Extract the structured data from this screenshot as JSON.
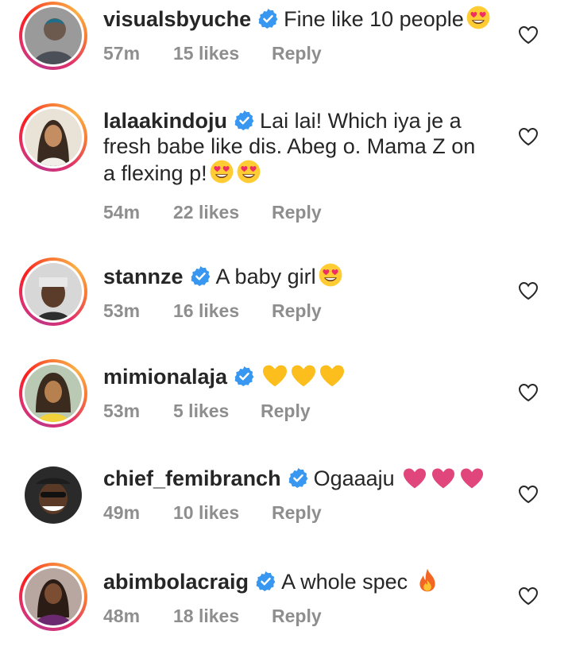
{
  "comments": [
    {
      "username": "visualsbyuche",
      "text": "Fine like 10 people",
      "emojis": [
        "heart-eyes-face"
      ],
      "time": "57m",
      "likes": "15 likes",
      "reply": "Reply"
    },
    {
      "username": "lalaakindoju",
      "text_lines": [
        "Lai lai! Which iya je a",
        "fresh babe like dis. Abeg o. Mama Z on",
        "a flexing p!"
      ],
      "emojis": [
        "heart-eyes-face",
        "heart-eyes-face"
      ],
      "time": "54m",
      "likes": "22 likes",
      "reply": "Reply"
    },
    {
      "username": "stannze",
      "text": "A baby girl",
      "emojis": [
        "heart-eyes-face"
      ],
      "time": "53m",
      "likes": "16 likes",
      "reply": "Reply"
    },
    {
      "username": "mimionalaja",
      "text": "",
      "emojis": [
        "yellow-heart",
        "yellow-heart",
        "yellow-heart"
      ],
      "time": "53m",
      "likes": "5 likes",
      "reply": "Reply"
    },
    {
      "username": "chief_femibranch",
      "text": "Ogaaaju",
      "emojis": [
        "pink-heart",
        "pink-heart",
        "pink-heart"
      ],
      "time": "49m",
      "likes": "10 likes",
      "reply": "Reply"
    },
    {
      "username": "abimbolacraig",
      "text": "A whole spec",
      "emojis": [
        "fire"
      ],
      "time": "48m",
      "likes": "18 likes",
      "reply": "Reply"
    }
  ],
  "colors": {
    "verified": "#3897f0",
    "meta": "#8e8e8e",
    "text": "#262626",
    "ring_start": "#c13584",
    "ring_end": "#fcaf45"
  }
}
